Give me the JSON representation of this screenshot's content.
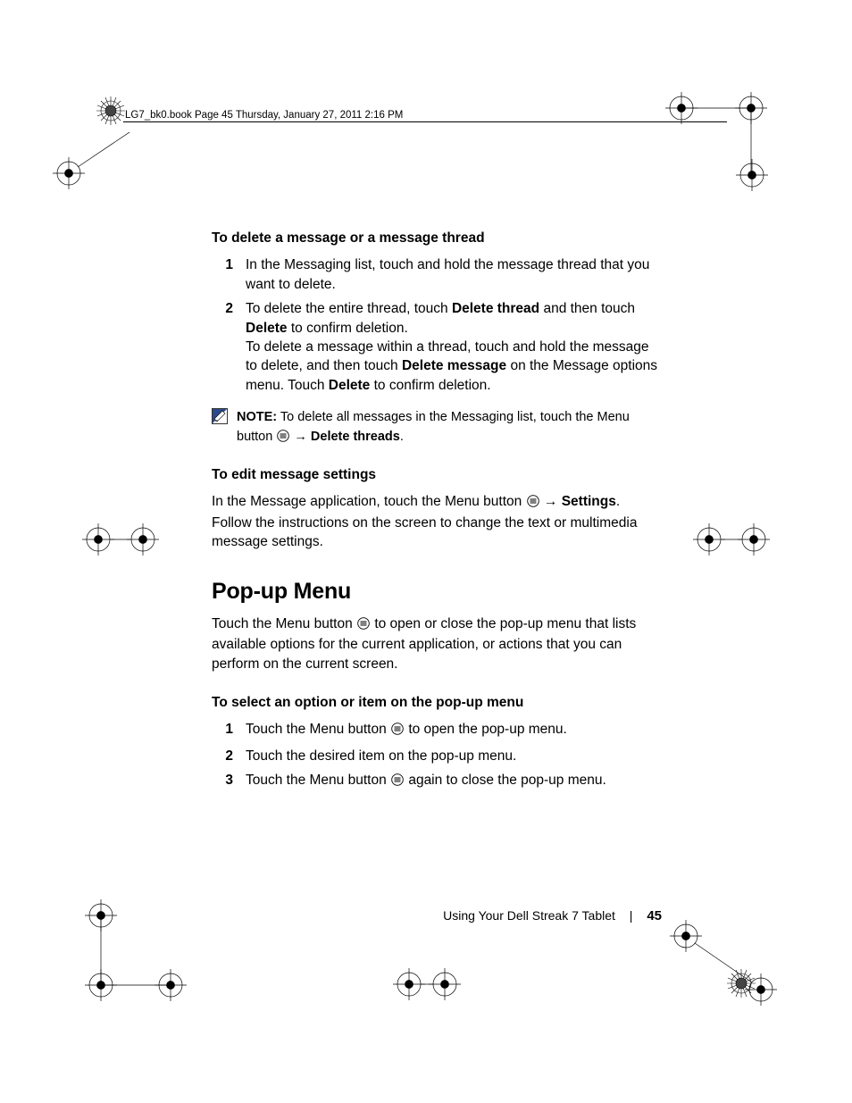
{
  "crop_header": "LG7_bk0.book  Page 45  Thursday, January 27, 2011  2:16 PM",
  "sec1": {
    "heading": "To delete a message or a message thread",
    "step1_num": "1",
    "step1_text": "In the Messaging list, touch and hold the message thread that you want to delete.",
    "step2_num": "2",
    "step2_a": "To delete the entire thread, touch ",
    "step2_b": "Delete thread",
    "step2_c": " and then touch ",
    "step2_d": "Delete",
    "step2_e": " to confirm deletion.",
    "step2_f": "To delete a message within a thread, touch and hold the message to delete, and then touch ",
    "step2_g": "Delete message",
    "step2_h": " on the Message options menu. Touch ",
    "step2_i": "Delete",
    "step2_j": " to confirm deletion."
  },
  "note1": {
    "label": "NOTE:",
    "a": " To delete all messages in the Messaging list, touch the Menu button ",
    "arrow": "→",
    "b": " ",
    "c": "Delete threads",
    "d": "."
  },
  "sec2": {
    "heading": "To edit message settings",
    "a": "In the Message application, touch the Menu button ",
    "arrow": "→",
    "b": " ",
    "c": "Settings",
    "d": ". Follow the instructions on the screen to change the text or multimedia message settings."
  },
  "popup": {
    "title": "Pop-up Menu",
    "intro_a": "Touch the Menu button ",
    "intro_b": " to open or close the pop-up menu that lists available options for the current application, or actions that you can perform on the current screen.",
    "heading": "To select an option or item on the pop-up menu",
    "s1_num": "1",
    "s1_a": "Touch the Menu button ",
    "s1_b": " to open the pop-up menu.",
    "s2_num": "2",
    "s2": "Touch the desired item on the pop-up menu.",
    "s3_num": "3",
    "s3_a": "Touch the Menu button ",
    "s3_b": " again to close the pop-up menu."
  },
  "footer": {
    "chapter": "Using Your Dell Streak 7 Tablet",
    "page": "45"
  }
}
